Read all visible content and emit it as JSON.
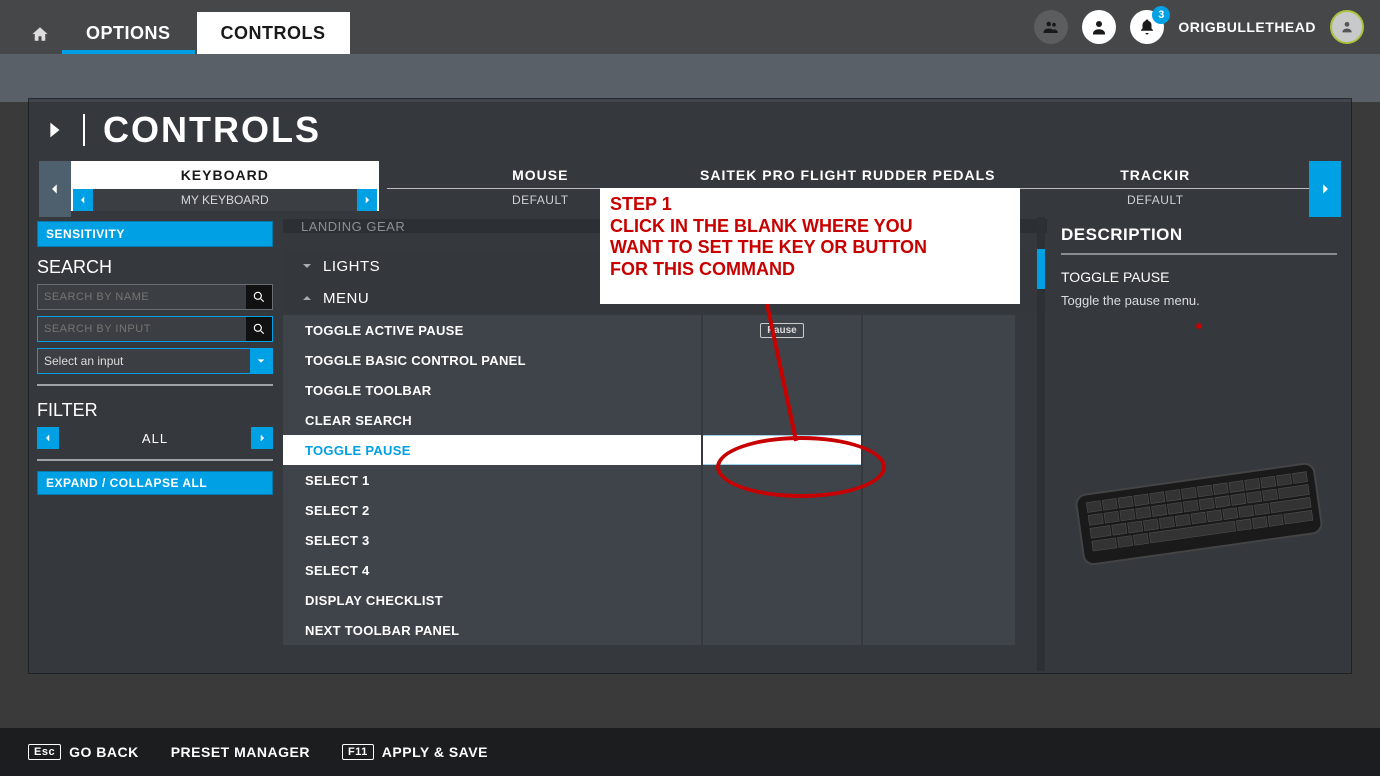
{
  "topbar": {
    "options_label": "OPTIONS",
    "controls_label": "CONTROLS",
    "username": "ORIGBULLETHEAD",
    "notification_count": "3"
  },
  "panel_title": "CONTROLS",
  "devices": {
    "keyboard": {
      "name": "KEYBOARD",
      "preset": "MY KEYBOARD"
    },
    "mouse": {
      "name": "MOUSE",
      "preset": "DEFAULT"
    },
    "saitek": {
      "name": "SAITEK PRO FLIGHT RUDDER PEDALS",
      "preset": ""
    },
    "trackir": {
      "name": "TRACKIR",
      "preset": "DEFAULT"
    }
  },
  "left": {
    "sensitivity": "SENSITIVITY",
    "search_title": "SEARCH",
    "search_name_ph": "SEARCH BY NAME",
    "search_input_ph": "SEARCH BY INPUT",
    "select_input": "Select an input",
    "filter_title": "FILTER",
    "filter_value": "ALL",
    "expand": "EXPAND / COLLAPSE ALL"
  },
  "categories": {
    "partial": "LANDING GEAR",
    "lights": "LIGHTS",
    "menu": "MENU"
  },
  "commands": [
    {
      "label": "TOGGLE ACTIVE PAUSE",
      "binding": "Pause",
      "selected": false
    },
    {
      "label": "TOGGLE BASIC CONTROL PANEL",
      "binding": "",
      "selected": false
    },
    {
      "label": "TOGGLE TOOLBAR",
      "binding": "",
      "selected": false
    },
    {
      "label": "CLEAR SEARCH",
      "binding": "",
      "selected": false
    },
    {
      "label": "TOGGLE PAUSE",
      "binding": "",
      "selected": true
    },
    {
      "label": "SELECT 1",
      "binding": "",
      "selected": false
    },
    {
      "label": "SELECT 2",
      "binding": "",
      "selected": false
    },
    {
      "label": "SELECT 3",
      "binding": "",
      "selected": false
    },
    {
      "label": "SELECT 4",
      "binding": "",
      "selected": false
    },
    {
      "label": "DISPLAY CHECKLIST",
      "binding": "",
      "selected": false
    },
    {
      "label": "NEXT TOOLBAR PANEL",
      "binding": "",
      "selected": false
    }
  ],
  "description": {
    "heading": "DESCRIPTION",
    "command": "TOGGLE PAUSE",
    "text": "Toggle the pause menu."
  },
  "annotation": {
    "step": "STEP 1",
    "line1": "CLICK IN THE BLANK WHERE YOU",
    "line2": "WANT TO SET THE KEY OR BUTTON",
    "line3": "FOR THIS COMMAND"
  },
  "bottombar": {
    "esc_key": "Esc",
    "goback": "GO BACK",
    "preset": "PRESET MANAGER",
    "f11_key": "F11",
    "apply": "APPLY & SAVE"
  }
}
